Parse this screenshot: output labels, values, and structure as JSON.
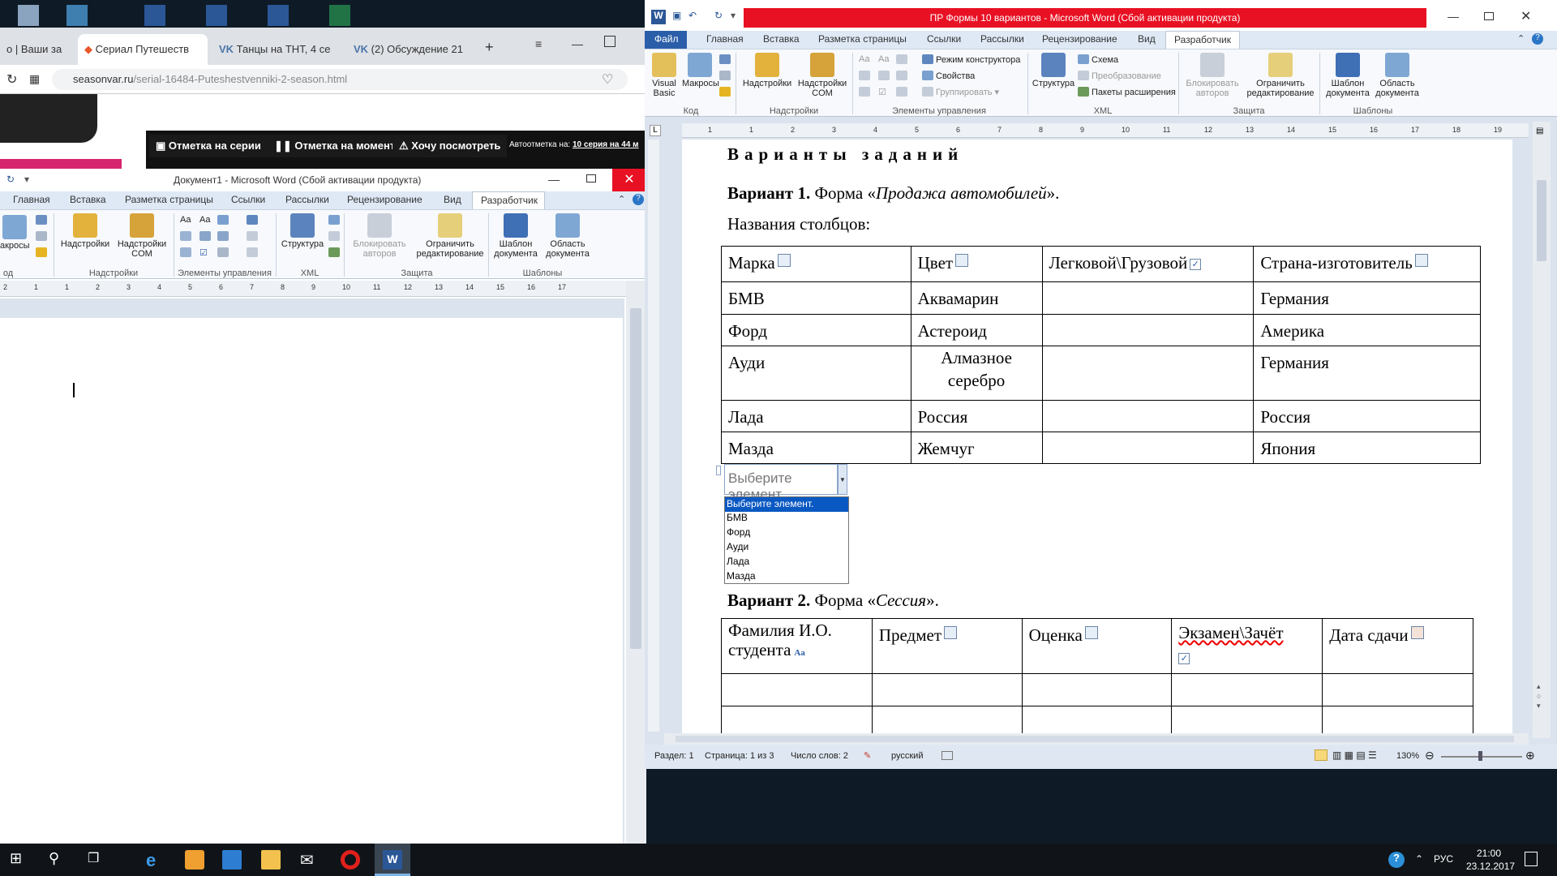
{
  "browser": {
    "tabs": [
      {
        "label": "о | Ваши за"
      },
      {
        "label": "Сериал Путешеств"
      },
      {
        "label": "Танцы на ТНТ, 4 се"
      },
      {
        "label": "(2) Обсуждение 21"
      }
    ],
    "url_host": "seasonvar.ru",
    "url_path": "/serial-16484-Puteshestvenniki-2-season.html",
    "site_buttons": [
      "Отметка на серии",
      "Отметка на моменте",
      "Хочу посмотреть"
    ],
    "autonote_label": "Автоотметка на:",
    "autonote_value": "10 серия на 44 м"
  },
  "word_left": {
    "title": "Документ1 - Microsoft Word (Сбой активации продукта)",
    "tabs": [
      "Главная",
      "Вставка",
      "Разметка страницы",
      "Ссылки",
      "Рассылки",
      "Рецензирование",
      "Вид",
      "Разработчик"
    ],
    "ribbon": {
      "macros": "акросы",
      "code_group": "од",
      "addins": "Надстройки",
      "addins_com": "Надстройки COM",
      "addins_group": "Надстройки",
      "controls_group": "Элементы управления",
      "structure": "Структура",
      "xml_group": "XML",
      "block_authors": "Блокировать авторов",
      "restrict_editing": "Ограничить редактирование",
      "protect_group": "Защита",
      "doc_template": "Шаблон документа",
      "doc_pane": "Область документа",
      "templates_group": "Шаблоны"
    },
    "ruler_marks": [
      "2",
      "1",
      "1",
      "2",
      "3",
      "4",
      "5",
      "6",
      "7",
      "8",
      "9",
      "10",
      "11",
      "12",
      "13",
      "14",
      "15",
      "16",
      "17"
    ]
  },
  "word_right": {
    "title": "ПР Формы 10 вариантов - Microsoft Word (Сбой активации продукта)",
    "title_bar_color": "#e81123",
    "tabs": [
      "Файл",
      "Главная",
      "Вставка",
      "Разметка страницы",
      "Ссылки",
      "Рассылки",
      "Рецензирование",
      "Вид",
      "Разработчик"
    ],
    "ribbon": {
      "visual_basic": "Visual Basic",
      "macros": "Макросы",
      "code_group": "Код",
      "addins": "Надстройки",
      "addins_com": "Надстройки COM",
      "addins_group": "Надстройки",
      "design_mode": "Режим конструктора",
      "properties": "Свойства",
      "group": "Группировать",
      "controls_group": "Элементы управления",
      "structure": "Структура",
      "schema": "Схема",
      "transform": "Преобразование",
      "expansion_packs": "Пакеты расширения",
      "xml_group": "XML",
      "block_authors": "Блокировать авторов",
      "restrict_editing": "Ограничить редактирование",
      "protect_group": "Защита",
      "doc_template": "Шаблон документа",
      "doc_pane": "Область документа",
      "templates_group": "Шаблоны"
    },
    "ruler_marks": [
      "1",
      "1",
      "2",
      "3",
      "4",
      "5",
      "6",
      "7",
      "8",
      "9",
      "10",
      "11",
      "12",
      "13",
      "14",
      "15",
      "16",
      "17",
      "18",
      "19"
    ],
    "doc": {
      "heading": "Варианты заданий",
      "variant1_bold": "Вариант 1.",
      "variant1_text": "Форма «",
      "variant1_italic": "Продажа автомобилей",
      "variant1_end": "».",
      "columns_label": "Названия столбцов:",
      "table1_headers": [
        "Марка",
        "Цвет",
        "Легковой\\Грузовой",
        "Страна-изготовитель"
      ],
      "table1_rows": [
        [
          "БМВ",
          "Аквамарин",
          "",
          "Германия"
        ],
        [
          "Форд",
          "Астероид",
          "",
          "Америка"
        ],
        [
          "Ауди",
          "Алмазное серебро",
          "",
          "Германия"
        ],
        [
          "Лада",
          "Россия",
          "",
          "Россия"
        ],
        [
          "Мазда",
          "Жемчуг",
          "",
          "Япония"
        ]
      ],
      "dropdown_placeholder": "Выберите элемент.",
      "dropdown_options": [
        "Выберите элемент.",
        "БМВ",
        "Форд",
        "Ауди",
        "Лада",
        "Мазда"
      ],
      "variant2_bold": "Вариант 2.",
      "variant2_text": "Форма «",
      "variant2_italic": "Сессия",
      "variant2_end": "».",
      "table2_headers": [
        "Фамилия И.О. студента",
        "Предмет",
        "Оценка",
        "Экзамен\\Зачёт",
        "Дата сдачи"
      ]
    },
    "status": {
      "section": "Раздел: 1",
      "page": "Страница: 1 из 3",
      "words": "Число слов: 2",
      "language": "русский",
      "zoom": "130%"
    }
  },
  "taskbar": {
    "lang": "РУС",
    "time": "21:00",
    "date": "23.12.2017"
  }
}
